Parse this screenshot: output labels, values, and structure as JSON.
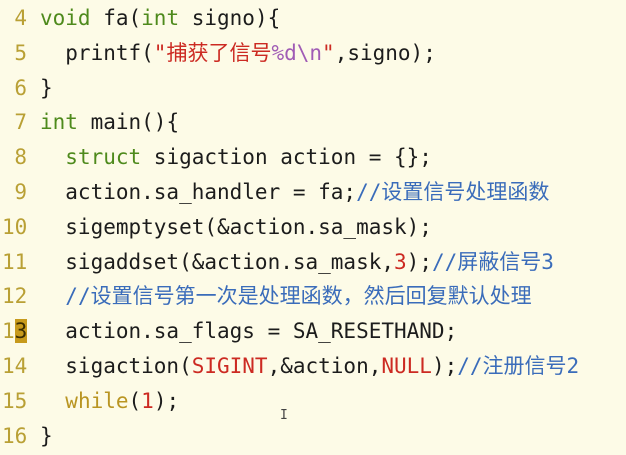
{
  "editor": {
    "cursor_line": 13,
    "lines": [
      {
        "num": "4",
        "tokens": [
          [
            "void",
            "kw"
          ],
          [
            " fa(",
            "plain"
          ],
          [
            "int",
            "kw"
          ],
          [
            " signo){",
            "plain"
          ]
        ]
      },
      {
        "num": "5",
        "tokens": [
          [
            "  printf(",
            "plain"
          ],
          [
            "\"捕获了信号",
            "str"
          ],
          [
            "%d\\n",
            "fmt"
          ],
          [
            "\"",
            "str"
          ],
          [
            ",signo);",
            "plain"
          ]
        ]
      },
      {
        "num": "6",
        "tokens": [
          [
            "}",
            "plain"
          ]
        ]
      },
      {
        "num": "7",
        "tokens": [
          [
            "int",
            "kw"
          ],
          [
            " main(){",
            "plain"
          ]
        ]
      },
      {
        "num": "8",
        "tokens": [
          [
            "  ",
            "plain"
          ],
          [
            "struct",
            "kw"
          ],
          [
            " sigaction action = {};",
            "plain"
          ]
        ]
      },
      {
        "num": "9",
        "tokens": [
          [
            "  action.sa_handler = fa;",
            "plain"
          ],
          [
            "//设置信号处理函数",
            "cmt"
          ]
        ]
      },
      {
        "num": "10",
        "tokens": [
          [
            "  sigemptyset(&action.sa_mask);",
            "plain"
          ]
        ]
      },
      {
        "num": "11",
        "tokens": [
          [
            "  sigaddset(&action.sa_mask,",
            "plain"
          ],
          [
            "3",
            "num"
          ],
          [
            ");",
            "plain"
          ],
          [
            "//屏蔽信号3",
            "cmt"
          ]
        ]
      },
      {
        "num": "12",
        "tokens": [
          [
            "  ",
            "plain"
          ],
          [
            "//设置信号第一次是处理函数，然后回复默认处理",
            "cmt"
          ]
        ]
      },
      {
        "num": "13",
        "tokens": [
          [
            "  action.sa_flags = SA_RESETHAND;",
            "plain"
          ]
        ]
      },
      {
        "num": "14",
        "tokens": [
          [
            "  sigaction(",
            "plain"
          ],
          [
            "SIGINT",
            "const"
          ],
          [
            ",&action,",
            "plain"
          ],
          [
            "NULL",
            "const"
          ],
          [
            ");",
            "plain"
          ],
          [
            "//注册信号2",
            "cmt"
          ]
        ]
      },
      {
        "num": "15",
        "tokens": [
          [
            "  ",
            "plain"
          ],
          [
            "while",
            "ctrl"
          ],
          [
            "(",
            "plain"
          ],
          [
            "1",
            "num"
          ],
          [
            ");",
            "plain"
          ]
        ]
      },
      {
        "num": "16",
        "tokens": [
          [
            "}",
            "plain"
          ]
        ]
      }
    ]
  },
  "mouse_cursor": "I"
}
